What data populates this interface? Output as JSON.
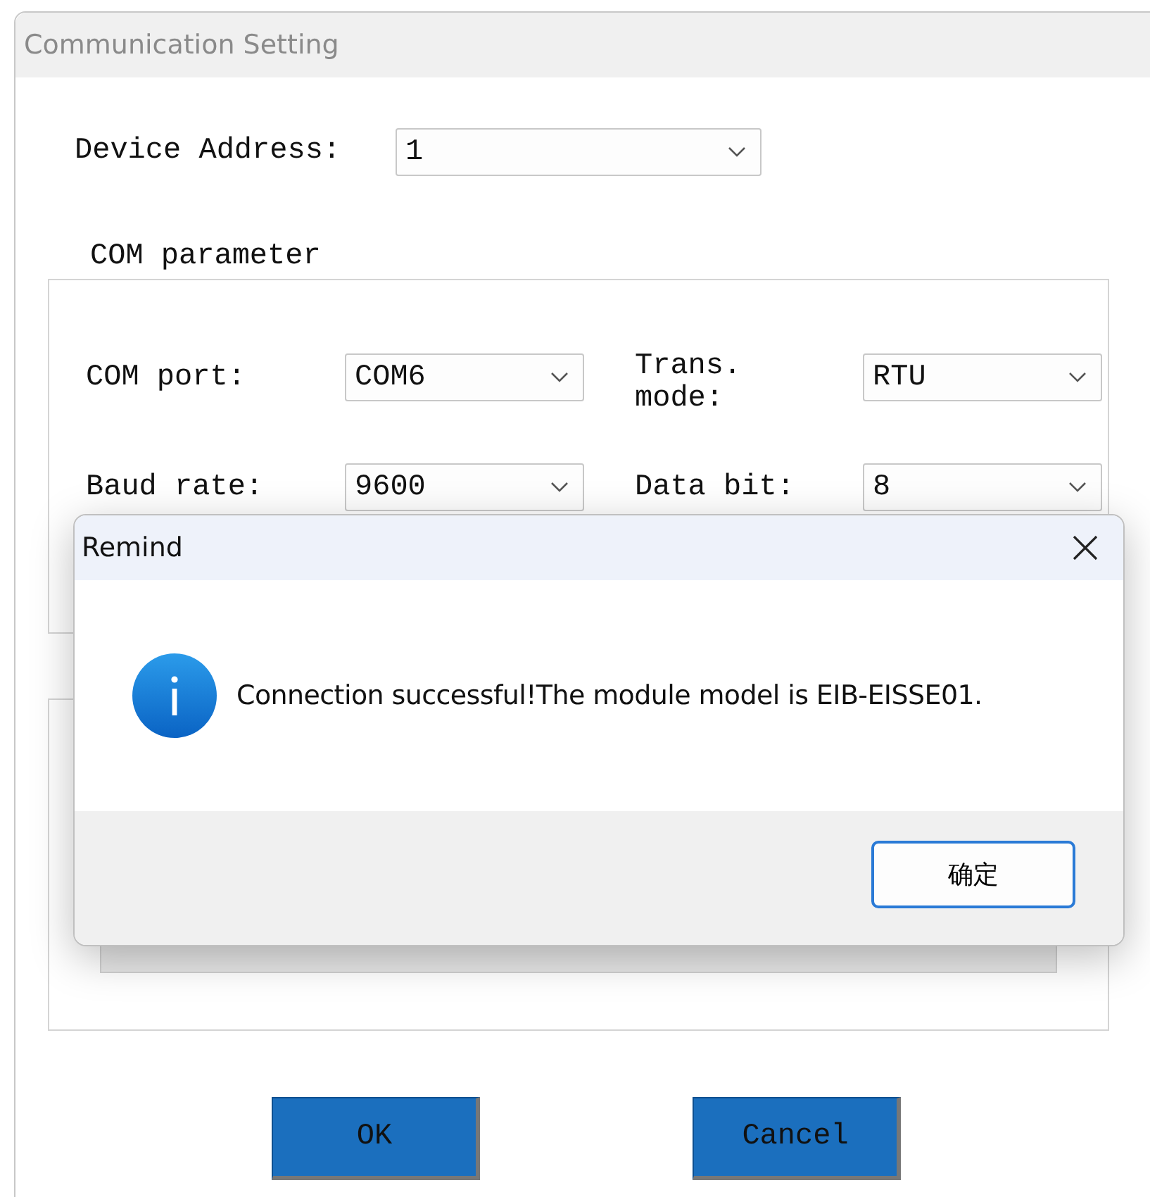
{
  "window": {
    "title": "Communication Setting"
  },
  "device_address": {
    "label": "Device Address:",
    "value": "1"
  },
  "com_parameter": {
    "title": "COM parameter",
    "fields": [
      {
        "label": "COM port:",
        "value": "COM6"
      },
      {
        "label": "Trans. mode:",
        "value": "RTU"
      },
      {
        "label": "Baud rate:",
        "value": "9600"
      },
      {
        "label": "Data bit:",
        "value": "8"
      }
    ]
  },
  "buttons": [
    {
      "label": "OK"
    },
    {
      "label": "Cancel"
    }
  ],
  "dialog": {
    "title": "Remind",
    "message": "Connection successful!The module model is EIB-EISSE01.",
    "button": "确定"
  }
}
